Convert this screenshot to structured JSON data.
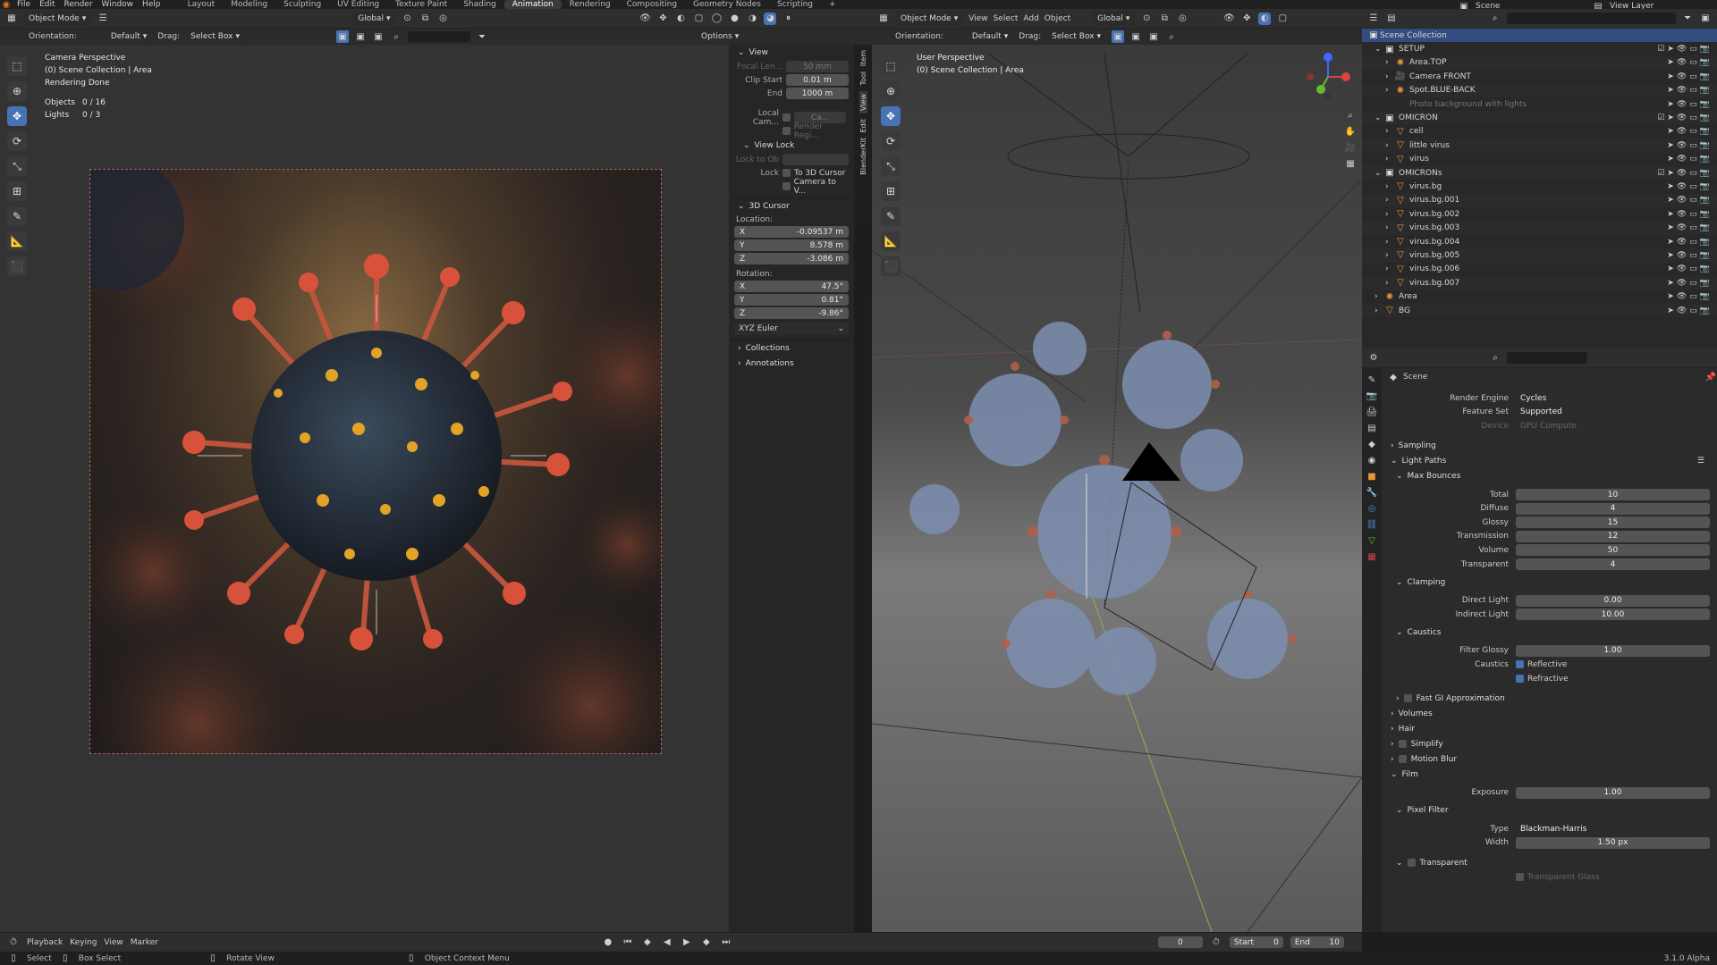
{
  "menu": {
    "items": [
      "File",
      "Edit",
      "Render",
      "Window",
      "Help"
    ]
  },
  "workspaces": {
    "items": [
      "Layout",
      "Modeling",
      "Sculpting",
      "UV Editing",
      "Texture Paint",
      "Shading",
      "Animation",
      "Rendering",
      "Compositing",
      "Geometry Nodes",
      "Scripting"
    ],
    "active": "Animation"
  },
  "scene_name": "Scene",
  "view_layer": "View Layer",
  "left_view": {
    "mode": "Object Mode",
    "transform": "Global",
    "orientation_label": "Orientation:",
    "orientation_value": "Default",
    "drag_label": "Drag:",
    "drag_value": "Select Box",
    "options": "Options",
    "overlay": {
      "line1": "Camera Perspective",
      "line2": "(0) Scene Collection | Area",
      "line3": "Rendering Done",
      "objects_label": "Objects",
      "objects_value": "0 / 16",
      "lights_label": "Lights",
      "lights_value": "0 / 3"
    }
  },
  "npanel": {
    "tabs": [
      "Item",
      "Tool",
      "View",
      "Edit",
      "BlenderKit"
    ],
    "view_header": "View",
    "focal_label": "Focal Len...",
    "focal_value": "50 mm",
    "clip_start_label": "Clip Start",
    "clip_start_value": "0.01 m",
    "end_label": "End",
    "end_value": "1000 m",
    "local_cam_label": "Local Cam...",
    "local_cam_value": "Ca...",
    "render_region": "Render Regi...",
    "view_lock_header": "View Lock",
    "lock_to_ob": "Lock to Ob",
    "lock_label": "Lock",
    "to_3d_cursor": "To 3D Cursor",
    "camera_to_view": "Camera to V...",
    "cursor_header": "3D Cursor",
    "location_label": "Location:",
    "loc_x": "-0.09537 m",
    "loc_y": "8.578 m",
    "loc_z": "-3.086 m",
    "rotation_label": "Rotation:",
    "rot_x": "47.5°",
    "rot_y": "0.81°",
    "rot_z": "-9.86°",
    "x": "X",
    "y": "Y",
    "z": "Z",
    "euler": "XYZ Euler",
    "collections": "Collections",
    "annotations": "Annotations"
  },
  "right_view": {
    "mode": "Object Mode",
    "menus": [
      "View",
      "Select",
      "Add",
      "Object"
    ],
    "transform": "Global",
    "orientation_label": "Orientation:",
    "orientation_value": "Default",
    "drag_label": "Drag:",
    "drag_value": "Select Box",
    "overlay": {
      "line1": "User Perspective",
      "line2": "(0) Scene Collection | Area"
    }
  },
  "outliner": {
    "root": "Scene Collection",
    "rows": [
      {
        "name": "SETUP",
        "indent": 0,
        "type": "collection"
      },
      {
        "name": "Area.TOP",
        "indent": 1,
        "type": "light"
      },
      {
        "name": "Camera FRONT",
        "indent": 1,
        "type": "camera"
      },
      {
        "name": "Spot.BLUE-BACK",
        "indent": 1,
        "type": "light"
      },
      {
        "name": "Photo background with lights",
        "indent": 1,
        "type": "dim"
      },
      {
        "name": "OMICRON",
        "indent": 0,
        "type": "collection"
      },
      {
        "name": "cell",
        "indent": 1,
        "type": "mesh"
      },
      {
        "name": "little virus",
        "indent": 1,
        "type": "mesh"
      },
      {
        "name": "virus",
        "indent": 1,
        "type": "mesh"
      },
      {
        "name": "OMICRONs",
        "indent": 0,
        "type": "collection"
      },
      {
        "name": "virus.bg",
        "indent": 1,
        "type": "mesh"
      },
      {
        "name": "virus.bg.001",
        "indent": 1,
        "type": "mesh"
      },
      {
        "name": "virus.bg.002",
        "indent": 1,
        "type": "mesh"
      },
      {
        "name": "virus.bg.003",
        "indent": 1,
        "type": "mesh"
      },
      {
        "name": "virus.bg.004",
        "indent": 1,
        "type": "mesh"
      },
      {
        "name": "virus.bg.005",
        "indent": 1,
        "type": "mesh"
      },
      {
        "name": "virus.bg.006",
        "indent": 1,
        "type": "mesh"
      },
      {
        "name": "virus.bg.007",
        "indent": 1,
        "type": "mesh"
      },
      {
        "name": "Area",
        "indent": 0,
        "type": "light"
      },
      {
        "name": "BG",
        "indent": 0,
        "type": "mesh"
      }
    ]
  },
  "properties": {
    "context": "Scene",
    "render_engine_label": "Render Engine",
    "render_engine": "Cycles",
    "feature_set_label": "Feature Set",
    "feature_set": "Supported",
    "device_label": "Device",
    "device": "GPU Compute",
    "sampling": "Sampling",
    "light_paths": "Light Paths",
    "max_bounces": "Max Bounces",
    "total_label": "Total",
    "total": "10",
    "diffuse_label": "Diffuse",
    "diffuse": "4",
    "glossy_label": "Glossy",
    "glossy": "15",
    "transmission_label": "Transmission",
    "transmission": "12",
    "volume_label": "Volume",
    "volume": "50",
    "transparent_label": "Transparent",
    "transparent": "4",
    "clamping": "Clamping",
    "direct_light_label": "Direct Light",
    "direct_light": "0.00",
    "indirect_light_label": "Indirect Light",
    "indirect_light": "10.00",
    "caustics": "Caustics",
    "filter_glossy_label": "Filter Glossy",
    "filter_glossy": "1.00",
    "caustics_label": "Caustics",
    "reflective": "Reflective",
    "refractive": "Refractive",
    "fast_gi": "Fast GI Approximation",
    "volumes": "Volumes",
    "hair": "Hair",
    "simplify": "Simplify",
    "motion_blur": "Motion Blur",
    "film": "Film",
    "exposure_label": "Exposure",
    "exposure": "1.00",
    "pixel_filter": "Pixel Filter",
    "type_label": "Type",
    "type": "Blackman-Harris",
    "width_label": "Width",
    "width": "1.50 px",
    "transparent_panel": "Transparent",
    "transparent_glass": "Transparent Glass"
  },
  "timeline": {
    "menus": [
      "Playback",
      "Keying",
      "View",
      "Marker"
    ],
    "current_frame": "0",
    "start_label": "Start",
    "start": "0",
    "end_label": "End",
    "end": "10"
  },
  "statusbar": {
    "select": "Select",
    "box_select": "Box Select",
    "rotate_view": "Rotate View",
    "context_menu": "Object Context Menu",
    "version": "3.1.0 Alpha"
  },
  "colors": {
    "accent": "#4772b3",
    "bg": "#1d1d1d",
    "panel": "#2e2e2e"
  }
}
